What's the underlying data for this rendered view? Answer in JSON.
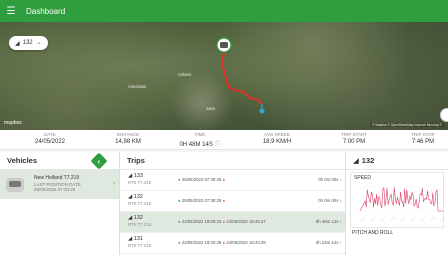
{
  "app": {
    "title": "Dashboard"
  },
  "map": {
    "trip_chip_label": "132",
    "logo": "mapbox",
    "attribution": "© Mapbox © OpenStreetMap Improve this map ©",
    "places": [
      "Avezzano",
      "Sora",
      "Celano"
    ]
  },
  "stats": [
    {
      "label": "DATE",
      "value": "24/05/2022"
    },
    {
      "label": "DISTANCE",
      "value": "14,98 KM"
    },
    {
      "label": "TIME",
      "value": "0H 48M 14S"
    },
    {
      "label": "AVG SPEED",
      "value": "18,9 KM/H"
    },
    {
      "label": "TRIP START",
      "value": "7:00 PM"
    },
    {
      "label": "TRIP STOP",
      "value": "7:46 PM"
    }
  ],
  "vehicles": {
    "header": "Vehicles",
    "items": [
      {
        "name": "New Holland T7.219",
        "status": "LAST POSITION DATE",
        "date": "25/05/2022 07:33:26"
      }
    ]
  },
  "trips": {
    "header": "Trips",
    "rows": [
      {
        "id": "133",
        "vehicle": "RTK T7.219",
        "start": "25/05/2022 07:30:29",
        "end": "",
        "duration": "0h 0m 00s"
      },
      {
        "id": "132",
        "vehicle": "RTK T7.219",
        "start": "25/05/2022 07:38:28",
        "end": "",
        "duration": "0h 0m 00s"
      },
      {
        "id": "132",
        "vehicle": "RTK T7.219",
        "start": "24/05/2022 19:00:33",
        "end": "24/05/2022 19:45:47",
        "duration": "0h 48m 14s"
      },
      {
        "id": "131",
        "vehicle": "RTK T7.219",
        "start": "24/05/2022 18:20:29",
        "end": "24/05/2022 18:44:29",
        "duration": "0h 24m 14s"
      }
    ]
  },
  "detail": {
    "header": "132",
    "speed_title": "SPEED",
    "pitch_title": "PITCH AND ROLL"
  },
  "colors": {
    "brand": "#2f9e3e",
    "route": "#e0302b",
    "speed_line": "#d9456a"
  }
}
